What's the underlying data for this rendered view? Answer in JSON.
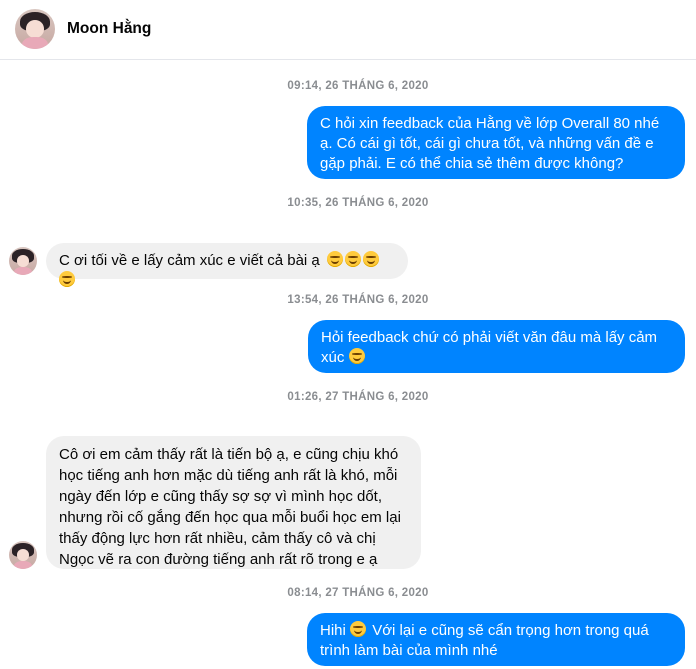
{
  "header": {
    "contact_name": "Moon Hằng",
    "avatar": "profile-photo"
  },
  "colors": {
    "outgoing": "#0084ff",
    "incoming": "#f0f0f0",
    "timestamp": "#8a8d91"
  },
  "messages": [
    {
      "timestamp": "09:14, 26 THÁNG 6, 2020"
    },
    {
      "direction": "out",
      "text": "C hỏi xin feedback của Hằng về lớp Overall 80 nhé ạ. Có cái gì tốt, cái gì chưa tốt, và những vấn đề e gặp phải. E có thể chia sẻ thêm được không?"
    },
    {
      "timestamp": "10:35, 26 THÁNG 6, 2020"
    },
    {
      "direction": "in",
      "text": "C ơi tối về e lấy cảm xúc e viết cả bài ạ",
      "emoji": "grinning-emoji x4"
    },
    {
      "timestamp": "13:54, 26 THÁNG 6, 2020"
    },
    {
      "direction": "out",
      "text": "Hỏi feedback chứ có phải viết văn đâu mà lấy cảm xúc",
      "emoji": "grinning-emoji"
    },
    {
      "timestamp": "01:26, 27 THÁNG 6, 2020"
    },
    {
      "direction": "in",
      "text": "Cô ơi em cảm thấy rất là tiến bộ ạ, e cũng chịu khó học tiếng anh hơn mặc dù tiếng anh rất là khó, mỗi ngày đến lớp e cũng thấy sợ sợ vì mình học dốt, nhưng rồi cố gắng đến học qua mỗi buổi học em lại thấy động lực hơn rất nhiều, cảm thấy cô và chị Ngọc vẽ ra con đường tiếng anh rất rõ trong e ạ"
    },
    {
      "timestamp": "08:14, 27 THÁNG 6, 2020"
    },
    {
      "direction": "out",
      "text_before": "Hihi",
      "text_after": "Với lại e cũng sẽ cẩn trọng hơn trong quá trình làm bài của mình nhé",
      "emoji": "grinning-emoji"
    }
  ]
}
